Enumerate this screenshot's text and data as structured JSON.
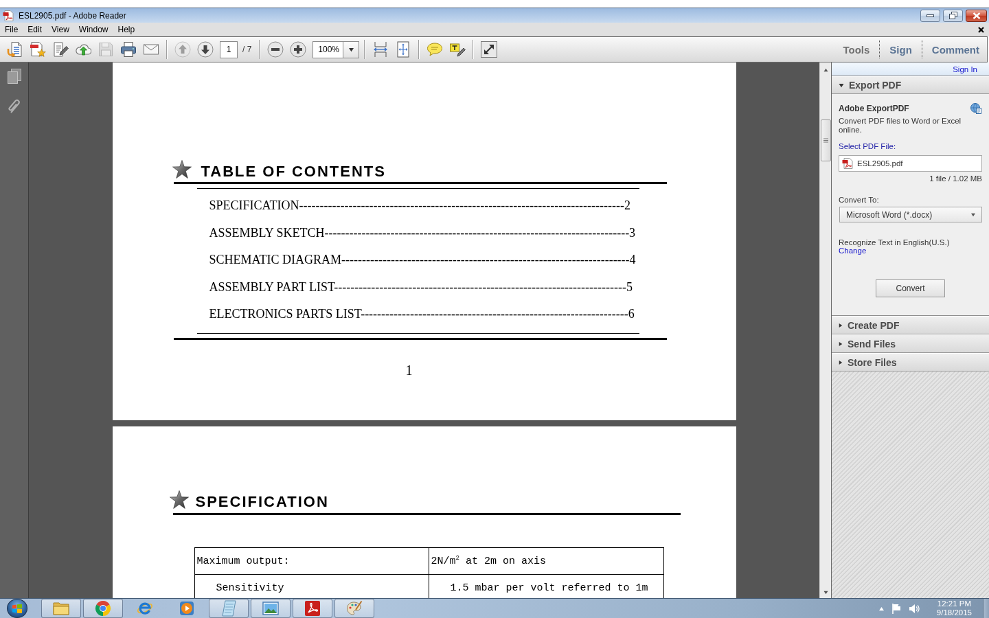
{
  "window": {
    "title": "ESL2905.pdf - Adobe Reader"
  },
  "menu": [
    "File",
    "Edit",
    "View",
    "Window",
    "Help"
  ],
  "toolbar": {
    "groups": [
      [
        {
          "kind": "export",
          "disabled": false
        },
        {
          "kind": "create",
          "disabled": false
        },
        {
          "kind": "edit",
          "disabled": false
        },
        {
          "kind": "upload",
          "disabled": false
        },
        {
          "kind": "save",
          "disabled": true
        },
        {
          "kind": "print",
          "disabled": false
        },
        {
          "kind": "email",
          "disabled": false
        }
      ],
      [
        {
          "kind": "previous",
          "disabled": true
        },
        {
          "kind": "next",
          "disabled": false
        },
        {
          "kind": "page_field",
          "disabled": false,
          "value": "1",
          "count": "/ 7"
        }
      ],
      [
        {
          "kind": "zoom_out",
          "disabled": false
        },
        {
          "kind": "zoom_in",
          "disabled": false
        },
        {
          "kind": "zoom_field",
          "disabled": false,
          "value": "100%"
        }
      ],
      [
        {
          "kind": "fit_width",
          "disabled": false
        },
        {
          "kind": "fit_page",
          "disabled": false
        }
      ],
      [
        {
          "kind": "comment",
          "disabled": false
        },
        {
          "kind": "highlight",
          "disabled": false
        }
      ],
      [
        {
          "kind": "full_screen",
          "disabled": false
        }
      ]
    ],
    "panes": [
      "Tools",
      "Sign",
      "Comment"
    ]
  },
  "document": {
    "pages": [
      {
        "kind": "contents",
        "heading": "TABLE OF CONTENTS",
        "entries": [
          "SPECIFICATION-------------------------------------------------------------------------------2",
          "ASSEMBLY SKETCH--------------------------------------------------------------------------3",
          "SCHEMATIC DIAGRAM----------------------------------------------------------------------4",
          "ASSEMBLY PART LIST-----------------------------------------------------------------------5",
          "ELECTRONICS PARTS LIST-----------------------------------------------------------------6"
        ],
        "page_number": "1"
      },
      {
        "kind": "specification",
        "heading": "SPECIFICATION",
        "table": {
          "rows": [
            {
              "indented": false,
              "cells": [
                "Maximum output:",
                "2N/m$^{2}$ at 2m on axis"
              ]
            },
            {
              "indented": true,
              "cells": [
                "Sensitivity",
                "1.5 mbar per volt referred to 1m"
              ]
            }
          ]
        }
      }
    ]
  },
  "side_panel": {
    "sign_in": "Sign In",
    "sections": [
      {
        "title": "Export PDF",
        "expanded": true,
        "content": {
          "heading": "Adobe ExportPDF",
          "description": "Convert PDF files to Word or Excel online.",
          "file_label": "Select PDF File:",
          "file": "ESL2905.pdf",
          "file_info": "1 file / 1.02 MB",
          "convert_label": "Convert To:",
          "format": "Microsoft Word (*.docx)",
          "ocr_text": "Recognize Text in English(U.S.)",
          "ocr_link": "Change",
          "button": "Convert"
        }
      },
      {
        "title": "Create PDF",
        "expanded": false
      },
      {
        "title": "Send Files",
        "expanded": false
      },
      {
        "title": "Store Files",
        "expanded": false
      }
    ]
  },
  "taskbar": {
    "apps": [
      {
        "kind": "folder",
        "running": true
      },
      {
        "kind": "browser",
        "running": true
      },
      {
        "kind": "web",
        "running": false
      },
      {
        "kind": "media",
        "running": false
      },
      {
        "kind": "notes",
        "running": true
      },
      {
        "kind": "photos",
        "running": true
      },
      {
        "kind": "pdf",
        "running": true
      },
      {
        "kind": "paint",
        "running": true
      }
    ],
    "time": "12:21 PM",
    "date": "9/18/2015"
  }
}
